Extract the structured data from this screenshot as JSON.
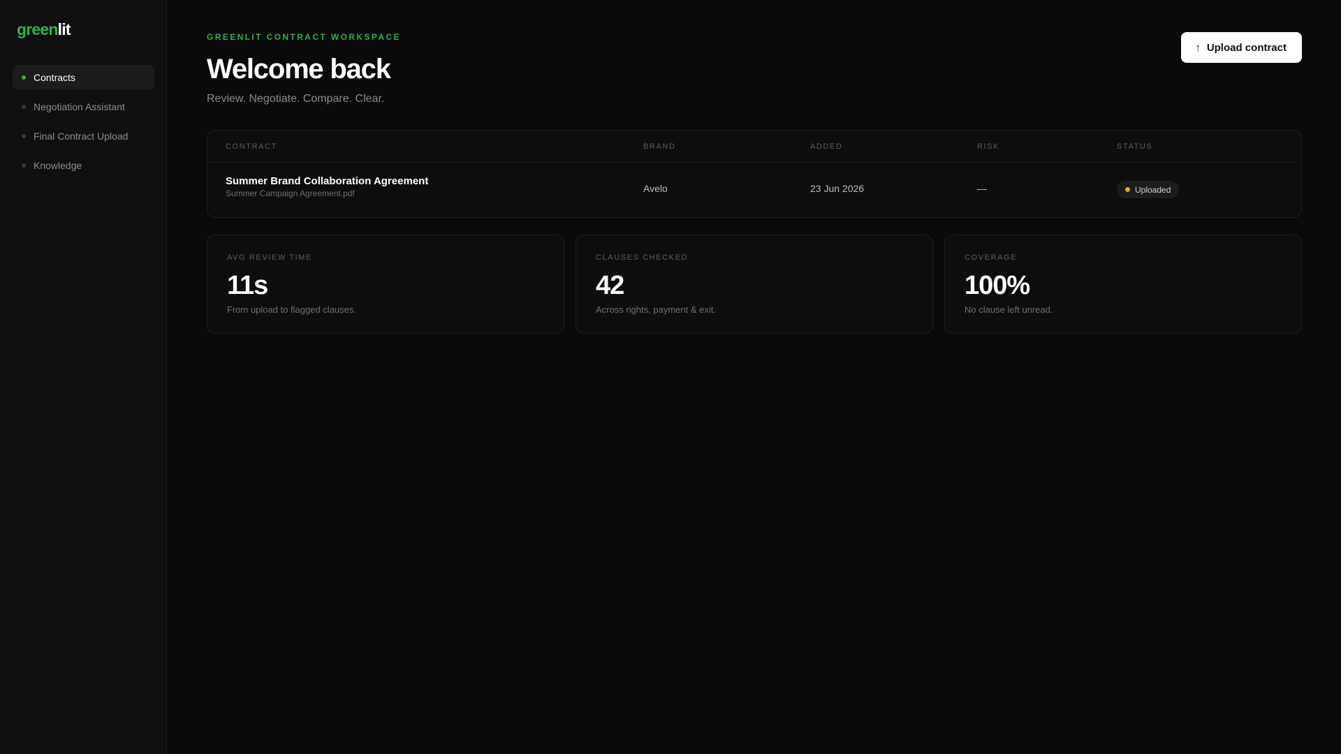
{
  "brand": {
    "logo_green": "green",
    "logo_white": "lit"
  },
  "sidebar": {
    "items": [
      {
        "label": "Contracts",
        "active": true
      },
      {
        "label": "Negotiation Assistant",
        "active": false
      },
      {
        "label": "Final Contract Upload",
        "active": false
      },
      {
        "label": "Knowledge",
        "active": false
      }
    ]
  },
  "header": {
    "eyebrow": "GREENLIT CONTRACT WORKSPACE",
    "title": "Welcome back",
    "subtitle": "Review. Negotiate. Compare. Clear.",
    "upload_label": "Upload contract",
    "upload_icon": "arrow-up-icon"
  },
  "table": {
    "columns": [
      "CONTRACT",
      "BRAND",
      "ADDED",
      "RISK",
      "STATUS"
    ],
    "rows": [
      {
        "name": "Summer Brand Collaboration Agreement",
        "file": "Summer Campaign Agreement.pdf",
        "brand": "Avelo",
        "added": "23 Jun 2026",
        "risk": "—",
        "status": "Uploaded"
      }
    ]
  },
  "stats": [
    {
      "label": "AVG REVIEW TIME",
      "value": "11s",
      "description": "From upload to flagged clauses."
    },
    {
      "label": "CLAUSES CHECKED",
      "value": "42",
      "description": "Across rights, payment & exit."
    },
    {
      "label": "COVERAGE",
      "value": "100%",
      "description": "No clause left unread."
    }
  ],
  "colors": {
    "accent": "#2fb052",
    "background": "#0a0a0a",
    "status_uploaded": "#f0a31c"
  }
}
